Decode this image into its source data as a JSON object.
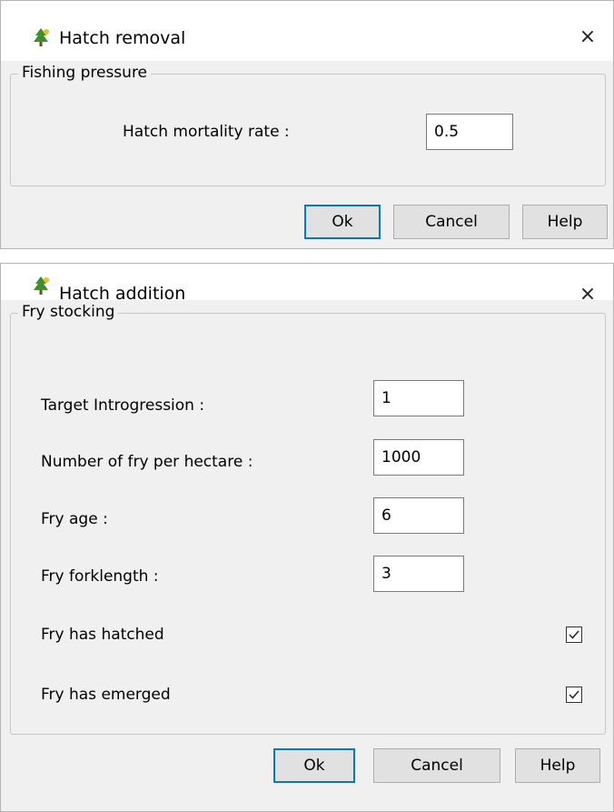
{
  "hatch_removal": {
    "title": "Hatch removal",
    "close_symbol": "×",
    "group_title": "Fishing pressure",
    "hatch_mortality_rate_label": "Hatch mortality rate :",
    "hatch_mortality_rate_value": "0.5",
    "ok_label": "Ok",
    "cancel_label": "Cancel",
    "help_label": "Help"
  },
  "hatch_addition": {
    "title": "Hatch addition",
    "close_symbol": "×",
    "group_title": "Fry stocking",
    "target_introgression_label": "Target Introgression :",
    "target_introgression_value": "1",
    "fry_per_hectare_label": "Number of fry per hectare :",
    "fry_per_hectare_value": "1000",
    "fry_age_label": "Fry age  :",
    "fry_age_value": "6",
    "fry_forklength_label": "Fry forklength :",
    "fry_forklength_value": "3",
    "fry_hatched_label": "Fry has hatched",
    "fry_hatched_checked": true,
    "fry_emerged_label": "Fry has emerged",
    "fry_emerged_checked": true,
    "ok_label": "Ok",
    "cancel_label": "Cancel",
    "help_label": "Help"
  },
  "icons": {
    "title_icon": "app-tree-icon",
    "checkmark": "checkmark-icon"
  },
  "colors": {
    "primary_button_border": "#0078d7",
    "content_background": "#f0f0f0"
  }
}
